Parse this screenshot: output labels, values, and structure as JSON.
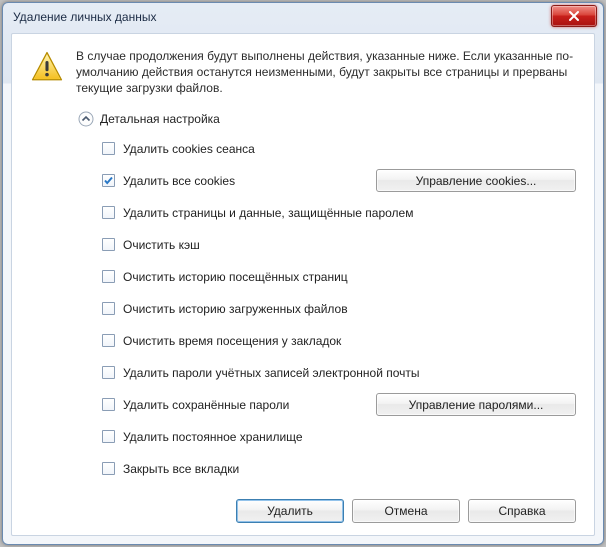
{
  "window": {
    "title": "Удаление личных данных"
  },
  "warning": {
    "text": "В случае продолжения будут выполнены действия, указанные ниже. Если указанные по-умолчанию действия останутся неизменными, будут закрыты все страницы и прерваны текущие загрузки файлов."
  },
  "details": {
    "title": "Детальная настройка"
  },
  "options": [
    {
      "label": "Удалить cookies сеанса",
      "checked": false
    },
    {
      "label": "Удалить все cookies",
      "checked": true,
      "sideButton": "Управление cookies..."
    },
    {
      "label": "Удалить страницы и данные, защищённые паролем",
      "checked": false
    },
    {
      "label": "Очистить кэш",
      "checked": false
    },
    {
      "label": "Очистить историю посещённых страниц",
      "checked": false
    },
    {
      "label": "Очистить историю загруженных файлов",
      "checked": false
    },
    {
      "label": "Очистить время посещения у закладок",
      "checked": false
    },
    {
      "label": "Удалить пароли учётных записей электронной почты",
      "checked": false
    },
    {
      "label": "Удалить сохранённые пароли",
      "checked": false,
      "sideButton": "Управление паролями..."
    },
    {
      "label": "Удалить постоянное хранилище",
      "checked": false
    },
    {
      "label": "Закрыть все вкладки",
      "checked": false
    }
  ],
  "buttons": {
    "delete": "Удалить",
    "cancel": "Отмена",
    "help": "Справка"
  }
}
